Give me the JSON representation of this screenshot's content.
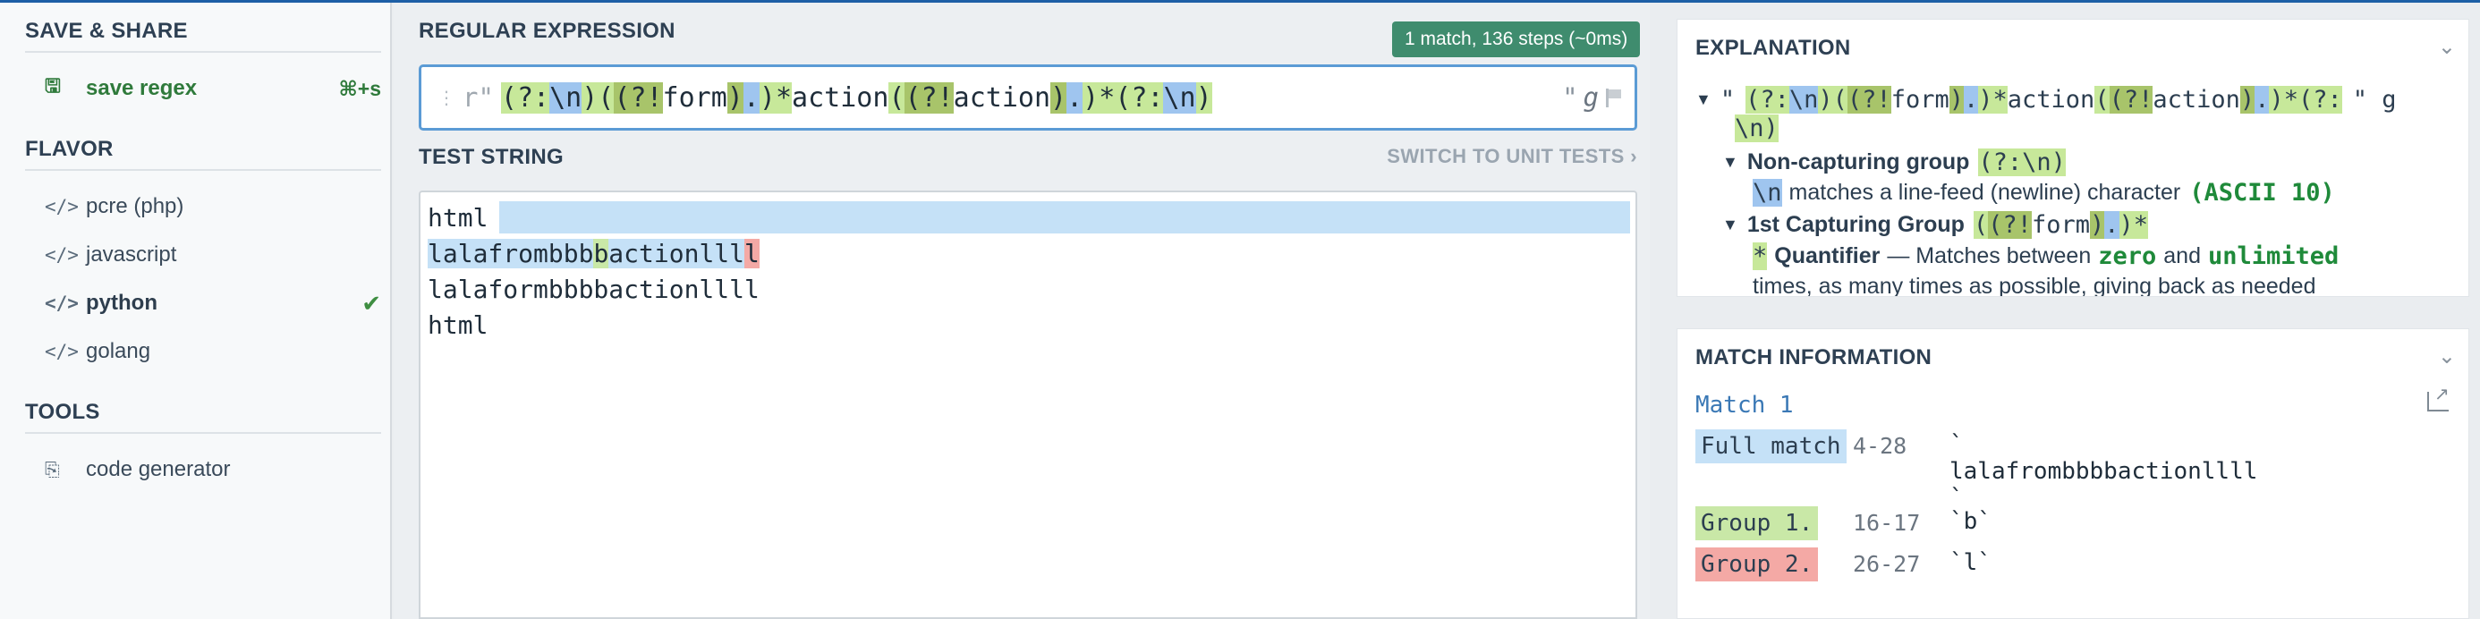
{
  "sidebar": {
    "save_share_title": "SAVE & SHARE",
    "save_label": "save regex",
    "save_shortcut": "⌘+s",
    "flavor_title": "FLAVOR",
    "flavors": [
      {
        "label": "pcre (php)",
        "active": false
      },
      {
        "label": "javascript",
        "active": false
      },
      {
        "label": "python",
        "active": true
      },
      {
        "label": "golang",
        "active": false
      }
    ],
    "tools_title": "TOOLS",
    "tools": [
      {
        "label": "code generator"
      }
    ],
    "flavor_icon": "</>"
  },
  "regex": {
    "section_title": "REGULAR EXPRESSION",
    "badge": "1 match, 136 steps (~0ms)",
    "prefix": "r\"",
    "suffix": "\"",
    "flags": "g",
    "tokens": [
      {
        "t": "(?:",
        "c": "nc"
      },
      {
        "t": "\\n",
        "c": "b"
      },
      {
        "t": ")",
        "c": "nc"
      },
      {
        "t": "(",
        "c": "g"
      },
      {
        "t": "(?!",
        "c": "dg"
      },
      {
        "t": "form",
        "c": ""
      },
      {
        "t": ")",
        "c": "dg"
      },
      {
        "t": ".",
        "c": "b"
      },
      {
        "t": ")*",
        "c": "g"
      },
      {
        "t": "action",
        "c": ""
      },
      {
        "t": "(",
        "c": "g"
      },
      {
        "t": "(?!",
        "c": "dg"
      },
      {
        "t": "action",
        "c": ""
      },
      {
        "t": ")",
        "c": "dg"
      },
      {
        "t": ".",
        "c": "b"
      },
      {
        "t": ")*",
        "c": "g"
      },
      {
        "t": "(?:",
        "c": "nc"
      },
      {
        "t": "\\n",
        "c": "b"
      },
      {
        "t": ")",
        "c": "nc"
      }
    ]
  },
  "test": {
    "section_title": "TEST STRING",
    "switch_label": "SWITCH TO UNIT TESTS",
    "lines": [
      "html",
      "lalafrombbbbactionllll",
      "lalaformbbbbactionllll",
      "html"
    ],
    "line2_parts": {
      "pre": "lalafrombbb",
      "g1": "b",
      "mid": "actionlll",
      "g2": "l"
    }
  },
  "explanation": {
    "title": "EXPLANATION",
    "root_quote_open": "\"",
    "root_quote_close": "\" g",
    "nc_title": "Non-capturing group",
    "nc_code": "(?:\\n)",
    "newline_token": "\\n",
    "newline_desc": "matches a line-feed (newline) character",
    "newline_ascii": "(ASCII 10)",
    "group1_title": "1st Capturing Group",
    "quant_token": "*",
    "quant_title": "Quantifier",
    "quant_desc_a": "— Matches between",
    "quant_zero": "zero",
    "quant_and": "and",
    "quant_unlimited": "unlimited",
    "quant_desc_b": "times, as many times as possible, giving back as needed"
  },
  "match_info": {
    "title": "MATCH INFORMATION",
    "match_label": "Match 1",
    "rows": [
      {
        "label": "Full match",
        "range": "4-28",
        "value": "`\nlalafrombbbbactionllll\n`"
      },
      {
        "label": "Group 1.",
        "range": "16-17",
        "value": "`b`"
      },
      {
        "label": "Group 2.",
        "range": "26-27",
        "value": "`l`"
      }
    ]
  },
  "colors": {
    "accent": "#1d5fa6",
    "badge": "#3f8c6e",
    "save_green": "#2f7a3b",
    "match_blue": "#c5e1f7",
    "group1_green": "#c9e8a7",
    "group2_red": "#f4a9a5"
  }
}
